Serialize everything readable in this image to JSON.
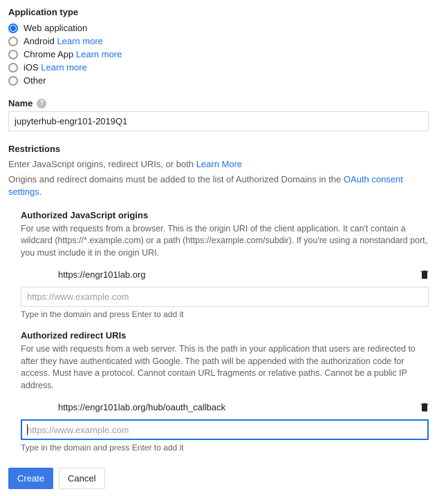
{
  "appType": {
    "heading": "Application type",
    "options": [
      {
        "label": "Web application",
        "selected": true,
        "learnMore": false
      },
      {
        "label": "Android",
        "selected": false,
        "learnMore": true
      },
      {
        "label": "Chrome App",
        "selected": false,
        "learnMore": true
      },
      {
        "label": "iOS",
        "selected": false,
        "learnMore": true
      },
      {
        "label": "Other",
        "selected": false,
        "learnMore": false
      }
    ],
    "learnMoreText": "Learn more"
  },
  "name": {
    "label": "Name",
    "value": "jupyterhub-engr101-2019Q1"
  },
  "restrictions": {
    "heading": "Restrictions",
    "desc": "Enter JavaScript origins, redirect URIs, or both",
    "learnMore": "Learn More",
    "note_pre": "Origins and redirect domains must be added to the list of Authorized Domains in the ",
    "note_link": "OAuth consent settings",
    "note_post": "."
  },
  "jsOrigins": {
    "heading": "Authorized JavaScript origins",
    "desc": "For use with requests from a browser. This is the origin URI of the client application. It can't contain a wildcard (https://*.example.com) or a path (https://example.com/subdir). If you're using a nonstandard port, you must include it in the origin URI.",
    "entries": [
      "https://engr101lab.org"
    ],
    "placeholder": "https://www.example.com",
    "hint": "Type in the domain and press Enter to add it"
  },
  "redirectUris": {
    "heading": "Authorized redirect URIs",
    "desc": "For use with requests from a web server. This is the path in your application that users are redirected to after they have authenticated with Google. The path will be appended with the authorization code for access. Must have a protocol. Cannot contain URL fragments or relative paths. Cannot be a public IP address.",
    "entries": [
      "https://engr101lab.org/hub/oauth_callback"
    ],
    "placeholder": "https://www.example.com",
    "hint": "Type in the domain and press Enter to add it"
  },
  "buttons": {
    "create": "Create",
    "cancel": "Cancel"
  }
}
